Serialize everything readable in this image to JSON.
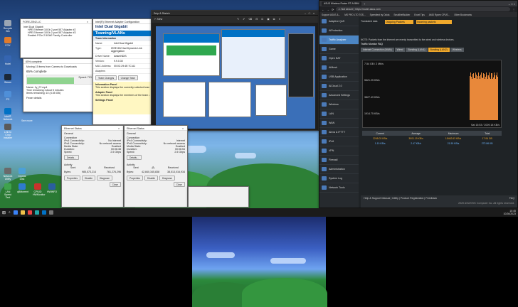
{
  "desktop_icons": [
    "Recycle Bin",
    "FOX",
    "Hotel",
    "Steam",
    "PC",
    "Intel® Network",
    "Link to Cmd Installer",
    "LAN Speed Test",
    "qBittorrent",
    "CPUID HWMonitor",
    "HWiNFO",
    "Network Utility",
    "Crystal Disk"
  ],
  "device_manager": {
    "title": "FORE-25N2-LC",
    "item1": "Intel Dual Gigabit",
    "item2": "HPE Ethernet 10Gb 2-port 557 Adapter #2",
    "item3": "HPE Ethernet 10Gb 2-port 557 Adapter #3",
    "item4": "Realtek PCIe 2.5GbE Family Controller"
  },
  "copy_dialog": {
    "title": "65% complete",
    "line1": "Moving 15 items from Camera to Downloads",
    "percent_label": "65% complete",
    "progress": 0.65,
    "speed": "Speed: 713 MB/s",
    "name": "Name: 1y_07.mp4",
    "remaining": "Time remaining: About 5 minutes",
    "items_remaining": "Items remaining: 10 (4.55 GB)",
    "fewer": "Fewer details",
    "see_more": "See more"
  },
  "intel": {
    "title": "Intel(R) Ethernet Adapter Configuration",
    "brand": "Intel Dual Gigabit",
    "section": "Teaming/VLANs",
    "team_info": "Team Information",
    "rows": [
      {
        "k": "Name:",
        "v": "Intel Dual Gigabit"
      },
      {
        "k": "Type:",
        "v": "IEEE 802.3ad Dynamic Link Aggregation"
      },
      {
        "k": "Driver Name:",
        "v": "iansmNDIS"
      },
      {
        "k": "Version:",
        "v": "9.9.0.30"
      },
      {
        "k": "MAC Address:",
        "v": "00:0C:29:4E:7C:A1"
      }
    ],
    "adapters": "Adapters",
    "team_changes": "Team Changes",
    "change_team": "Change Team",
    "info_panel": "Information Panel",
    "info_text": "This section displays the currently selected team information.",
    "adapter_panel": "Adapter Panel",
    "adapter_text": "This section displays the members of the team and their current status.",
    "settings_panel": "Settings Panel"
  },
  "snip": {
    "title": "Snip & Sketch",
    "new_label": "New"
  },
  "status1": {
    "title": "Ethernet Status",
    "general": "General",
    "connection": "Connection",
    "ipv4": "IPv4 Connectivity:",
    "ipv4_v": "No Internet",
    "ipv6": "IPv6 Connectivity:",
    "ipv6_v": "No network access",
    "media": "Media State:",
    "media_v": "Enabled",
    "duration": "Duration:",
    "duration_v": "00:06:38",
    "speed": "Speed:",
    "speed_v": "2.5 Gbps",
    "details": "Details...",
    "activity": "Activity",
    "sent": "Sent",
    "received": "Received",
    "bytes": "Bytes:",
    "bytes_sent": "985,573,214",
    "bytes_recv": "761,276,296",
    "properties": "Properties",
    "disable": "Disable",
    "diagnose": "Diagnose",
    "close": "Close"
  },
  "status2": {
    "title": "Ethernet Status",
    "general": "General",
    "connection": "Connection",
    "ipv4": "IPv4 Connectivity:",
    "ipv4_v": "Internet",
    "ipv6": "IPv6 Connectivity:",
    "ipv6_v": "No network access",
    "media": "Media State:",
    "media_v": "Enabled",
    "duration": "Duration:",
    "duration_v": "00:06:54",
    "speed": "Speed:",
    "speed_v": "2.5 Gbps",
    "details": "Details...",
    "activity": "Activity",
    "sent": "Sent",
    "received": "Received",
    "bytes": "Bytes:",
    "bytes_sent": "42,840,345,838",
    "bytes_recv": "38,513,016,934",
    "properties": "Properties",
    "disable": "Disable",
    "diagnose": "Diagnose",
    "close": "Close"
  },
  "browser": {
    "tab_title": "ASUS Wireless Router RT-AX86U",
    "tab2": "Supprot Forum",
    "url_label": "Not secure",
    "url": "https://router.asus.com",
    "bookmarks": [
      "Support ASUS &...",
      "MS PRO LTO TOS...",
      "Speedtest by Ookla",
      "SmallNetBuilder",
      "Excel Tips",
      "AMD Ryzen CPUS...",
      "Other Bookmarks"
    ]
  },
  "asus": {
    "menu": [
      "Adaptive QoS",
      "AiProtection",
      "Traffic Analyzer",
      "Game",
      "Open NAT",
      "AiMesh",
      "USB Application",
      "AiCloud 2.0",
      "Advanced Settings",
      "Wireless",
      "LAN",
      "WAN",
      "Alexa & IFTTT",
      "IPv6",
      "VPN",
      "Firewall",
      "Administration",
      "System Log",
      "Network Tools"
    ],
    "active_index": 2,
    "traffic_head1": "Translated data",
    "traffic_head2": "Outgoing Packets",
    "traffic_head3": "Incoming packets",
    "note": "NOTE: Packets from the Internet are evenly transmitted to the wired and wireless devices.",
    "monitor_title": "Traffic Monitor FAQ",
    "tabs": [
      "Internet Connection (WAN)",
      "Wired",
      "Bonding (LAN1)",
      "Bonding (LAN2)",
      "Wireless"
    ],
    "selected_tab": 3,
    "y_labels": [
      "7.54 GB / 2 Mb/s",
      "5621.25 KB/s",
      "3827.49 KB/s",
      "1914.75 KB/s"
    ],
    "peak_label": "Sat 15:53 / 2009.18 KB/s",
    "table_headers": [
      "Current",
      "Average",
      "Maximum",
      "Total"
    ],
    "row1": [
      "2248.03 KB/s",
      "3001.19 KB/s",
      "15462.63 KB/s",
      "17.06 GB"
    ],
    "row2": [
      "1.10 KB/s",
      "2.47 KB/s",
      "21.50 KB/s",
      "272.86 KB"
    ],
    "footer_links": "Help & Support  Manual | Utility | Product Registration | Feedback",
    "faq": "FAQ",
    "copyright": "2020 ASUSTeK Computer Inc. All rights reserved."
  },
  "taskbar": {
    "time": "10:45",
    "date": "10/26/2023"
  }
}
